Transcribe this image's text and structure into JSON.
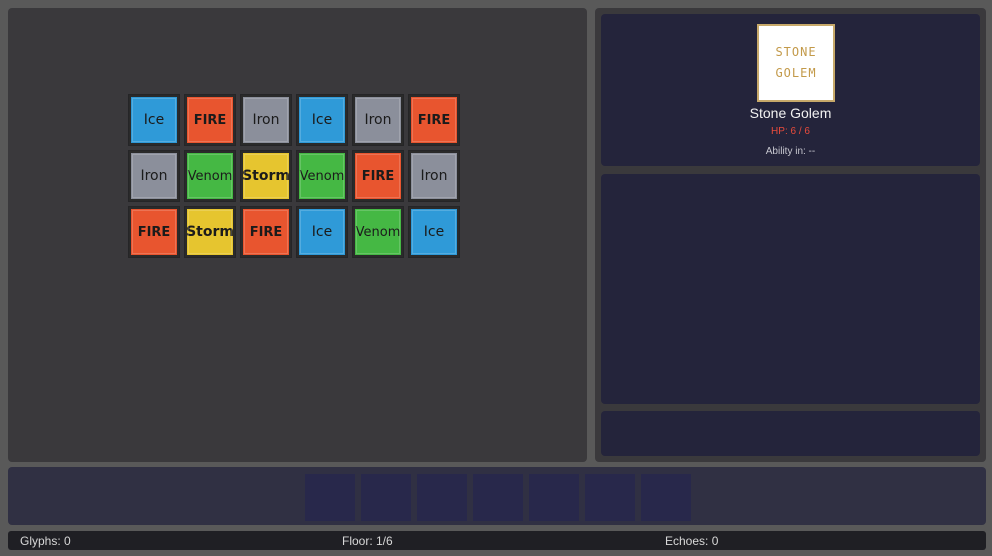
{
  "board": {
    "tiles": [
      {
        "label": "Ice",
        "type": "ice"
      },
      {
        "label": "FIRE",
        "type": "fire"
      },
      {
        "label": "Iron",
        "type": "iron"
      },
      {
        "label": "Ice",
        "type": "ice"
      },
      {
        "label": "Iron",
        "type": "iron"
      },
      {
        "label": "FIRE",
        "type": "fire"
      },
      {
        "label": "Iron",
        "type": "iron"
      },
      {
        "label": "Venom",
        "type": "venom"
      },
      {
        "label": "Storm",
        "type": "storm"
      },
      {
        "label": "Venom",
        "type": "venom"
      },
      {
        "label": "FIRE",
        "type": "fire"
      },
      {
        "label": "Iron",
        "type": "iron"
      },
      {
        "label": "FIRE",
        "type": "fire"
      },
      {
        "label": "Storm",
        "type": "storm"
      },
      {
        "label": "FIRE",
        "type": "fire"
      },
      {
        "label": "Ice",
        "type": "ice"
      },
      {
        "label": "Venom",
        "type": "venom"
      },
      {
        "label": "Ice",
        "type": "ice"
      }
    ],
    "colors": {
      "fire": "#e8552f",
      "ice": "#2f9ad8",
      "iron": "#8b8f9b",
      "venom": "#45b844",
      "storm": "#e6c52f"
    }
  },
  "enemy": {
    "portrait_line1": "STONE",
    "portrait_line2": "GOLEM",
    "name": "Stone Golem",
    "hp": "HP: 6 / 6",
    "ability": "Ability in: --",
    "hp_color": "#e94b3c"
  },
  "status": {
    "glyphs": "Glyphs: 0",
    "floor": "Floor: 1/6",
    "echoes": "Echoes: 0"
  }
}
